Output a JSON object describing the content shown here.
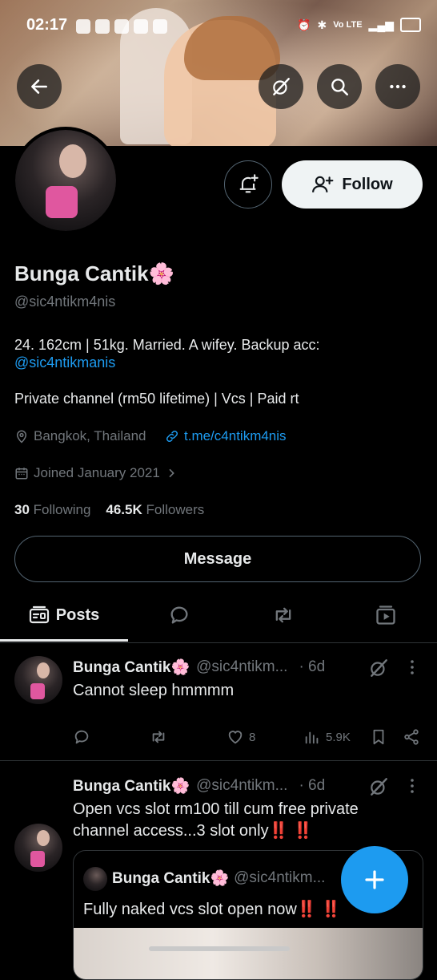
{
  "status_bar": {
    "time": "02:17",
    "right_text": "Vo LTE"
  },
  "profile": {
    "name": "Bunga Cantik",
    "name_emoji": "🌸",
    "handle": "@sic4ntikm4nis",
    "bio_line1": "24. 162cm | 51kg. Married. A wifey. Backup acc:",
    "bio_link": "@sic4ntikmanis",
    "bio_line2": "Private channel (rm50 lifetime) | Vcs | Paid rt",
    "location": "Bangkok, Thailand",
    "url": "t.me/c4ntikm4nis",
    "joined": "Joined January 2021",
    "following_count": "30",
    "following_label": "Following",
    "followers_count": "46.5K",
    "followers_label": "Followers"
  },
  "buttons": {
    "follow": "Follow",
    "message": "Message"
  },
  "tabs": [
    {
      "label": "Posts"
    }
  ],
  "tweets": [
    {
      "name": "Bunga Cantik",
      "emoji": "🌸",
      "handle": "@sic4ntikm...",
      "time": "· 6d",
      "text": "Cannot sleep hmmmm",
      "likes": "8",
      "views": "5.9K"
    },
    {
      "name": "Bunga Cantik",
      "emoji": "🌸",
      "handle": "@sic4ntikm...",
      "time": "· 6d",
      "text_line1": "Open vcs slot rm100 till cum free private",
      "text_line2": "channel access...3 slot only",
      "text_emoji": "‼️ ‼️",
      "quote": {
        "name": "Bunga Cantik",
        "emoji": "🌸",
        "handle": "@sic4ntikm...",
        "text": "Fully naked vcs slot open now",
        "text_emoji": "‼️ ‼️"
      }
    }
  ],
  "colors": {
    "accent": "#1d9bf0",
    "muted": "#71767b",
    "text": "#e7e9ea",
    "background": "#000000"
  }
}
